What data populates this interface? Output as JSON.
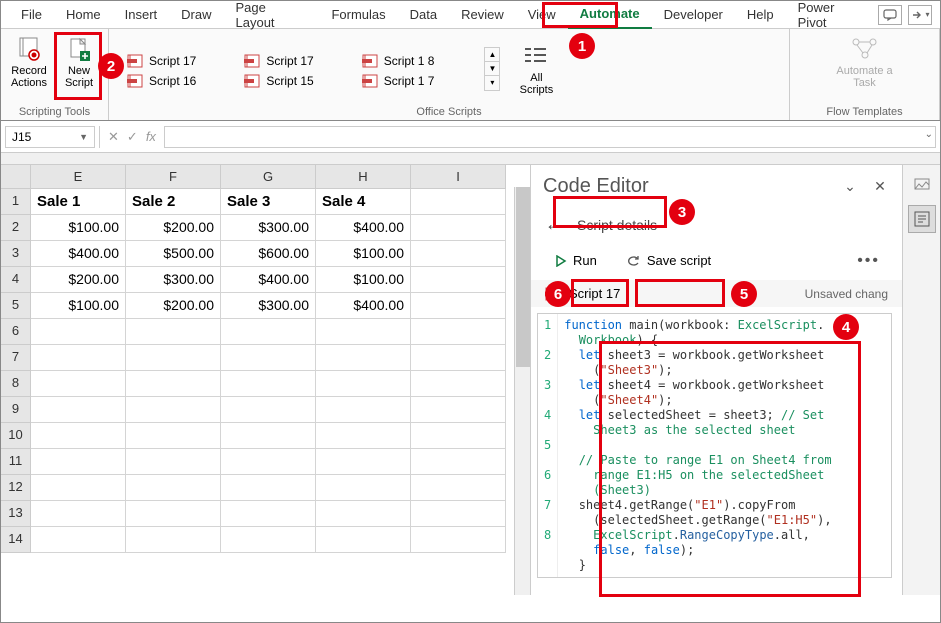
{
  "ribbon": {
    "tabs": [
      "File",
      "Home",
      "Insert",
      "Draw",
      "Page Layout",
      "Formulas",
      "Data",
      "Review",
      "View",
      "Automate",
      "Developer",
      "Help",
      "Power Pivot"
    ],
    "active_tab": "Automate",
    "groups": {
      "scripting_tools": {
        "label": "Scripting Tools",
        "record": "Record Actions",
        "new_script": "New Script"
      },
      "office_scripts": {
        "label": "Office Scripts",
        "col1": [
          "Script 17",
          "Script 16"
        ],
        "col2": [
          "Script 17",
          "Script 15"
        ],
        "col3": [
          "Script 1 8",
          "Script 1 7"
        ],
        "all_scripts": "All Scripts"
      },
      "flow_templates": {
        "label": "Flow Templates",
        "automate_task": "Automate a Task"
      }
    }
  },
  "name_box": "J15",
  "fx_label": "fx",
  "sheet": {
    "cols": [
      "E",
      "F",
      "G",
      "H",
      "I"
    ],
    "headers": [
      "Sale 1",
      "Sale 2",
      "Sale 3",
      "Sale 4",
      ""
    ],
    "rows": [
      [
        "$100.00",
        "$200.00",
        "$300.00",
        "$400.00",
        ""
      ],
      [
        "$400.00",
        "$500.00",
        "$600.00",
        "$100.00",
        ""
      ],
      [
        "$200.00",
        "$300.00",
        "$400.00",
        "$100.00",
        ""
      ],
      [
        "$100.00",
        "$200.00",
        "$300.00",
        "$400.00",
        ""
      ],
      [
        "",
        "",
        "",
        "",
        ""
      ],
      [
        "",
        "",
        "",
        "",
        ""
      ],
      [
        "",
        "",
        "",
        "",
        ""
      ],
      [
        "",
        "",
        "",
        "",
        ""
      ],
      [
        "",
        "",
        "",
        "",
        ""
      ],
      [
        "",
        "",
        "",
        "",
        ""
      ],
      [
        "",
        "",
        "",
        "",
        ""
      ],
      [
        "",
        "",
        "",
        "",
        ""
      ],
      [
        "",
        "",
        "",
        "",
        ""
      ]
    ]
  },
  "editor": {
    "title": "Code Editor",
    "back_label": "Script details",
    "run": "Run",
    "save": "Save script",
    "script_name": "Script 17",
    "status": "Unsaved chang",
    "gutter": [
      "1",
      "2",
      "3",
      "4",
      "5",
      "6",
      "7",
      "8"
    ]
  },
  "annotations": [
    "1",
    "2",
    "3",
    "4",
    "5",
    "6"
  ]
}
